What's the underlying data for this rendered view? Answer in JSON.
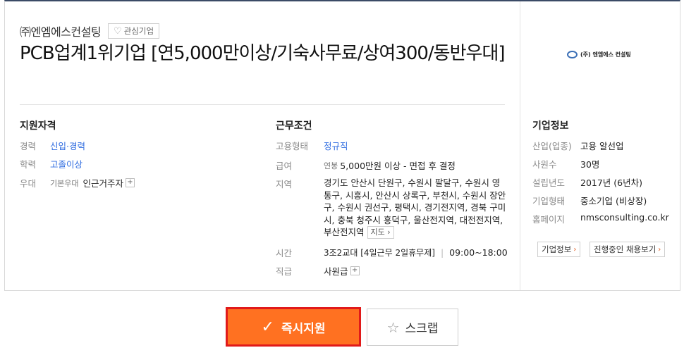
{
  "header": {
    "company_name": "㈜엔엠에스컨설팅",
    "favorite_label": "관심기업",
    "title": "PCB업계1위기업 [연5,000만이상/기숙사무료/상여300/동반우대]"
  },
  "qualifications": {
    "section_title": "지원자격",
    "experience_label": "경력",
    "experience_value": "신입·경력",
    "education_label": "학력",
    "education_value": "고졸이상",
    "preference_label": "우대",
    "preference_sub": "기본우대",
    "preference_value": "인근거주자"
  },
  "conditions": {
    "section_title": "근무조건",
    "type_label": "고용형태",
    "type_value": "정규직",
    "salary_label": "급여",
    "salary_prefix": "연봉",
    "salary_value": "5,000만원 이상 - 면접 후 결정",
    "region_label": "지역",
    "region_lines": [
      "경기도 안산시 단원구, 수원시 팔달구, 수원시 영",
      "통구, 시흥시, 안산시 상록구, 부천시, 수원시 장안",
      "구, 수원시 권선구, 평택시, 경기전지역, 경북 구미",
      "시, 충북 청주시 흥덕구, 울산전지역, 대전전지역,"
    ],
    "region_last": "부산전지역",
    "map_label": "지도",
    "time_label": "시간",
    "time_shift": "3조2교대 [4일근무 2일휴무제]",
    "time_hours": "09:00~18:00",
    "rank_label": "직급",
    "rank_value": "사원급"
  },
  "company": {
    "logo_text": "(주) 엔엠에스 컨설팅",
    "section_title": "기업정보",
    "industry_label": "산업(업종)",
    "industry_value": "고용 알선업",
    "employees_label": "사원수",
    "employees_value": "30명",
    "founded_label": "설립년도",
    "founded_value": "2017년 (6년차)",
    "type_label": "기업형태",
    "type_value": "중소기업 (비상장)",
    "homepage_label": "홈페이지",
    "homepage_value": "nmsconsulting.co.kr",
    "info_button": "기업정보",
    "jobs_button": "진행중인 채용보기"
  },
  "actions": {
    "apply_label": "즉시지원",
    "scrap_label": "스크랩"
  },
  "colors": {
    "accent": "#ff7121",
    "highlight_border": "#e11a1a",
    "link": "#2f6ce0"
  }
}
